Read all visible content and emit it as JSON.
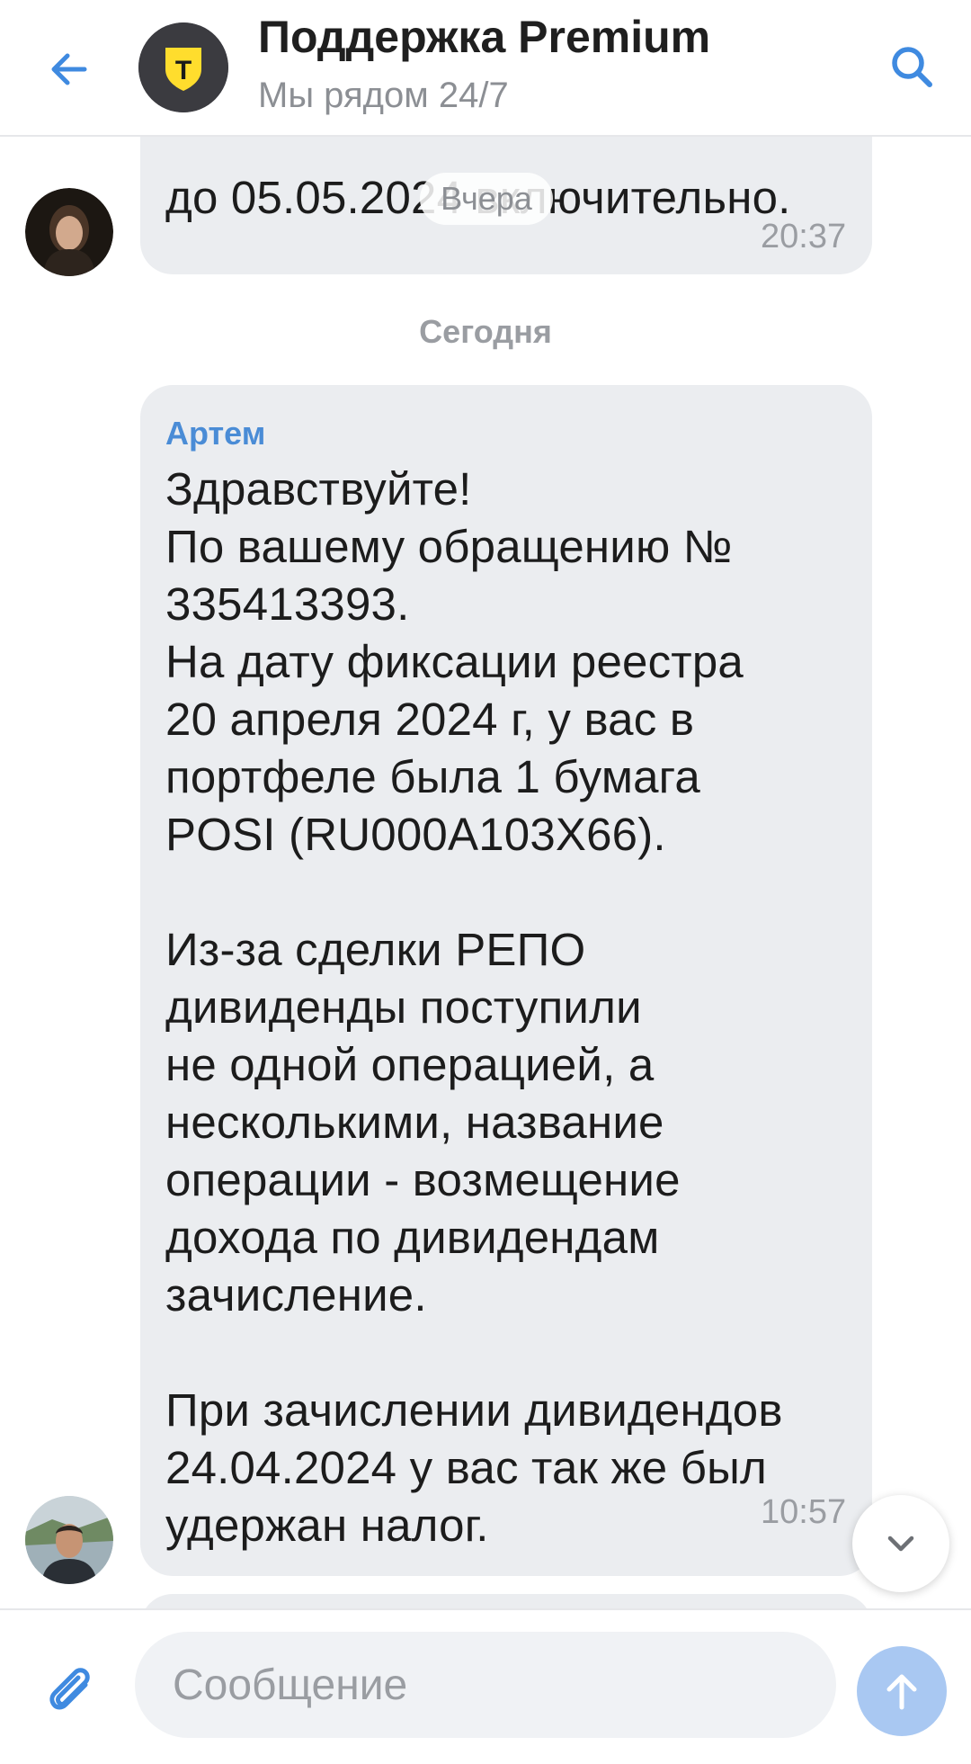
{
  "header": {
    "back_icon": "arrow-left-icon",
    "title": "Поддержка Premium",
    "subtitle": "Мы рядом 24/7",
    "logo_letter": "Т",
    "search_icon": "search-icon"
  },
  "chat": {
    "previous_message": {
      "text": "до 05.05.2024 включительно.",
      "time": "20:37"
    },
    "date_pill": "Вчера",
    "date_separator": "Сегодня",
    "message": {
      "sender": "Артем",
      "lines": [
        "Здравствуйте!",
        "По вашему обращению №",
        "335413393.",
        "На дату фиксации реестра",
        "20 апреля 2024 г, у вас в",
        "портфеле была 1 бумага",
        "POSI (RU000A103X66).",
        "",
        "Из-за сделки РЕПО",
        "дивиденды поступили",
        "не одной операцией, а",
        "несколькими, название",
        "операции - возмещение",
        "дохода по дивидендам",
        "зачисление.",
        "",
        "При зачислении дивидендов",
        "24.04.2024 у вас так же был",
        "удержан налог."
      ],
      "time": "10:57"
    }
  },
  "composer": {
    "placeholder": "Сообщение",
    "attach_icon": "paperclip-icon",
    "send_icon": "arrow-up-icon"
  },
  "colors": {
    "accent": "#4a8cd6",
    "bubble": "#ebedf0",
    "send_button": "#a9c8f2",
    "brand_yellow": "#ffdd2d"
  }
}
